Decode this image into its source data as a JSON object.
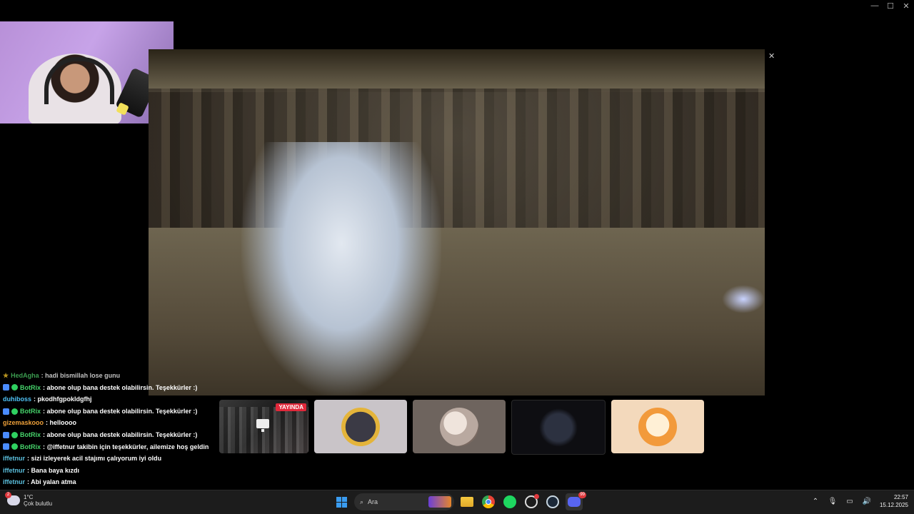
{
  "window": {
    "minimize": "—",
    "maximize": "☐",
    "close": "✕"
  },
  "video": {
    "close": "✕"
  },
  "chat": [
    {
      "user": "HedAgha",
      "color": "#4fd06a",
      "message": ": hadi bismillah lose gunu",
      "badges": [
        "star"
      ],
      "faded": true
    },
    {
      "user": "BotRix",
      "color": "#46d46b",
      "message": ": abone olup bana destek olabilirsin. Teşekkürler :)",
      "badges": [
        "bot",
        "verified"
      ]
    },
    {
      "user": "duhiboss",
      "color": "#4fc3f7",
      "message": ": pkodhfgpokldgfhj",
      "badges": []
    },
    {
      "user": "BotRix",
      "color": "#46d46b",
      "message": ": abone olup bana destek olabilirsin. Teşekkürler :)",
      "badges": [
        "bot",
        "verified"
      ]
    },
    {
      "user": "gizemaskooo",
      "color": "#f0a23a",
      "message": ": helloooo",
      "badges": []
    },
    {
      "user": "BotRix",
      "color": "#46d46b",
      "message": ": abone olup bana destek olabilirsin. Teşekkürler :)",
      "badges": [
        "bot",
        "verified"
      ]
    },
    {
      "user": "BotRix",
      "color": "#46d46b",
      "message": ": @iffetnur takibin için teşekkürler, ailemize hoş geldin",
      "badges": [
        "bot",
        "verified"
      ]
    },
    {
      "user": "iffetnur",
      "color": "#5bc0de",
      "message": ": sizi izleyerek acil stajımı çalıyorum iyi oldu",
      "badges": []
    },
    {
      "user": "iffetnur",
      "color": "#5bc0de",
      "message": ": Bana baya kızdı",
      "badges": []
    },
    {
      "user": "iffetnur",
      "color": "#5bc0de",
      "message": ": Abi yalan atma",
      "badges": []
    }
  ],
  "thumbs": {
    "live_label": "YAYINDA"
  },
  "taskbar": {
    "weather_temp": "1°C",
    "weather_desc": "Çok bulutlu",
    "search_placeholder": "Ara",
    "discord_badge": "99",
    "time": "22:57",
    "date": "15.12.2025"
  },
  "colors": {
    "live": "#e0283a",
    "accent": "#3a9cf0"
  }
}
